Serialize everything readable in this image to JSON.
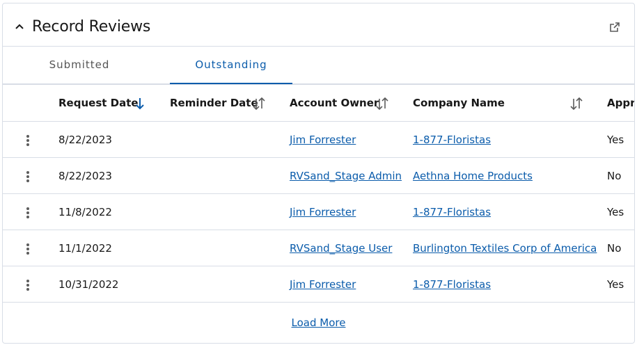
{
  "card": {
    "title": "Record Reviews",
    "collapse_icon": "chevron-up-icon",
    "popout_icon": "external-link-icon"
  },
  "tabs": [
    {
      "label": "Submitted",
      "active": false
    },
    {
      "label": "Outstanding",
      "active": true
    }
  ],
  "table": {
    "columns": [
      {
        "label": "Request Date",
        "sort": "descending"
      },
      {
        "label": "Reminder Date",
        "sort": "sortable"
      },
      {
        "label": "Account Owner",
        "sort": "sortable"
      },
      {
        "label": "Company Name",
        "sort": "sortable"
      },
      {
        "label": "Appro",
        "sort": "none"
      }
    ],
    "rows": [
      {
        "request_date": "8/22/2023",
        "reminder_date": "",
        "account_owner": "Jim Forrester",
        "company_name": "1-877-Floristas",
        "approved": "Yes"
      },
      {
        "request_date": "8/22/2023",
        "reminder_date": "",
        "account_owner": "RVSand_Stage Admin",
        "company_name": "Aethna Home Products",
        "approved": "No"
      },
      {
        "request_date": "11/8/2022",
        "reminder_date": "",
        "account_owner": "Jim Forrester",
        "company_name": "1-877-Floristas",
        "approved": "Yes"
      },
      {
        "request_date": "11/1/2022",
        "reminder_date": "",
        "account_owner": "RVSand_Stage User",
        "company_name": "Burlington Textiles Corp of America",
        "approved": "No"
      },
      {
        "request_date": "10/31/2022",
        "reminder_date": "",
        "account_owner": "Jim Forrester",
        "company_name": "1-877-Floristas",
        "approved": "Yes"
      }
    ]
  },
  "footer": {
    "load_more": "Load More"
  },
  "colors": {
    "accent": "#0b5cab",
    "border": "#d8dde6",
    "text": "#181818"
  }
}
